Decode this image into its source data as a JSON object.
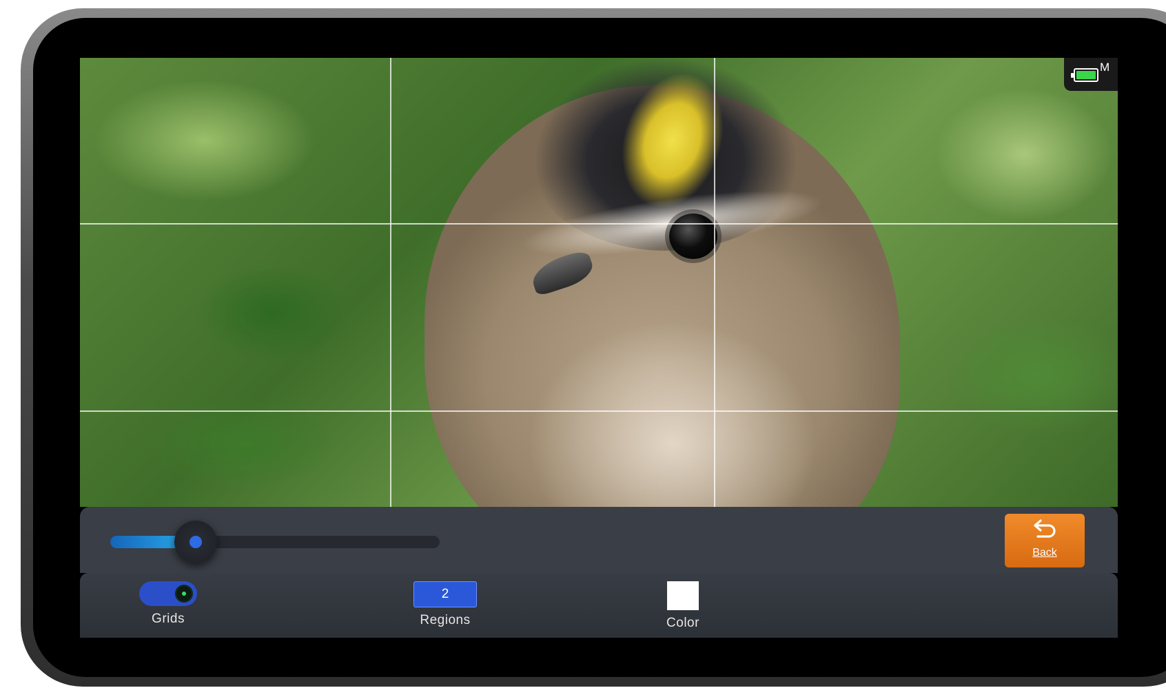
{
  "status": {
    "battery_mode": "M",
    "battery_icon": "battery-icon",
    "battery_color": "#3bd64a"
  },
  "slider": {
    "value_fraction": 0.26,
    "fill_color_start": "#1565b8",
    "fill_color_end": "#2ab0f0",
    "thumb_dot_color": "#2f6be6"
  },
  "back_button": {
    "label": "Back",
    "icon": "back-arrow-icon",
    "color": "#e77a1e"
  },
  "toolbar": {
    "grids": {
      "label": "Grids",
      "enabled": true,
      "toggle_color": "#2b4ec9"
    },
    "regions": {
      "label": "Regions",
      "value": "2",
      "box_color": "#2a58d8"
    },
    "color": {
      "label": "Color",
      "swatch": "#ffffff"
    }
  },
  "grid_overlay": {
    "columns": 3,
    "rows": 3,
    "line_color": "#ffffff"
  }
}
